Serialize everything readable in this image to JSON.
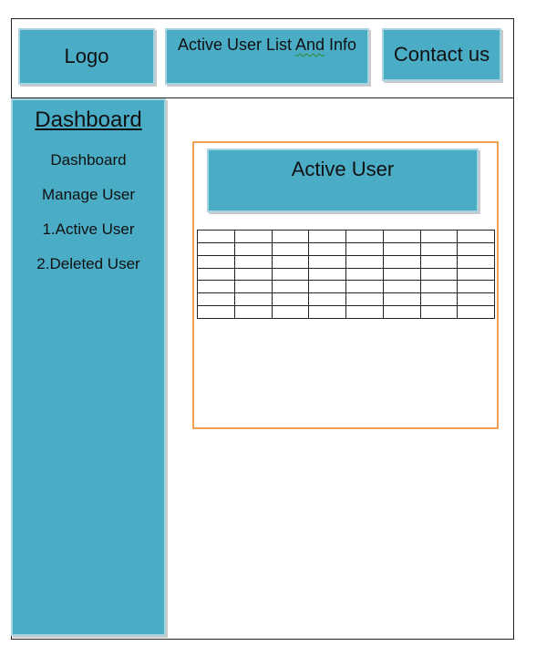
{
  "header": {
    "logo_label": "Logo",
    "title_pre": "Active User List ",
    "title_underlined": "And",
    "title_post": " Info",
    "contact_label": "Contact us"
  },
  "sidebar": {
    "title": "Dashboard",
    "items": [
      {
        "label": "Dashboard"
      },
      {
        "label": "Manage User"
      },
      {
        "label": "1.Active User"
      },
      {
        "label": "2.Deleted User"
      }
    ]
  },
  "main": {
    "panel_title": "Active User",
    "table": {
      "rows": 7,
      "cols": 8
    }
  },
  "colors": {
    "box_fill": "#4bacc6",
    "panel_border": "#f0a050"
  }
}
